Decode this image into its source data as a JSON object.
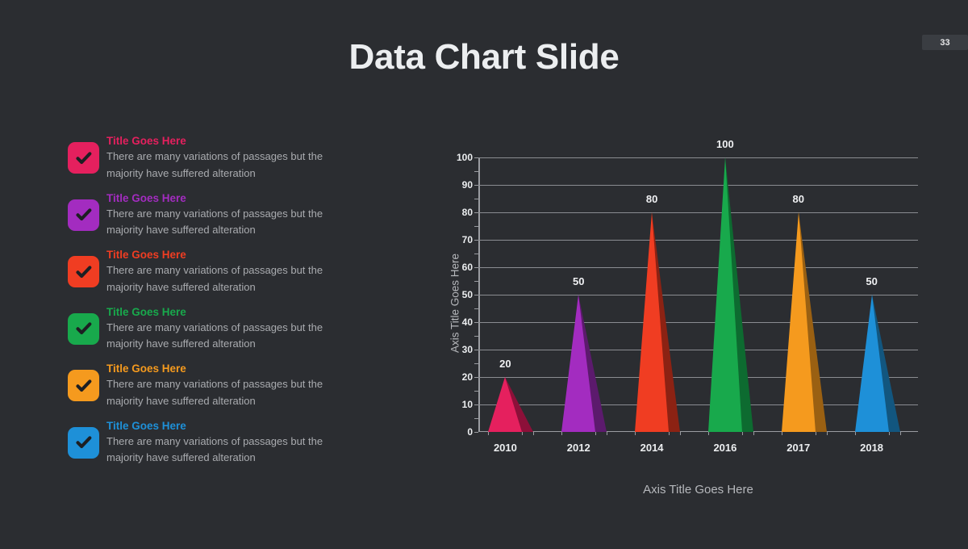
{
  "page": {
    "badge_number": "33",
    "title": "Data Chart Slide",
    "background": "#2b2d31"
  },
  "features": [
    {
      "icon": "check-square-icon",
      "color": "#e5205e",
      "title": "Title Goes Here",
      "line1": "There are many variations of passages but the",
      "line2": "majority have  suffered alteration"
    },
    {
      "icon": "check-square-icon",
      "color": "#a32cc0",
      "title": "Title Goes Here",
      "line1": "There are many variations of passages but the",
      "line2": "majority have  suffered alteration"
    },
    {
      "icon": "check-square-icon",
      "color": "#f03d22",
      "title": "Title Goes Here",
      "line1": "There are many variations of passages but the",
      "line2": "majority have  suffered alteration"
    },
    {
      "icon": "check-square-icon",
      "color": "#18a94c",
      "title": "Title Goes Here",
      "line1": "There are many variations of passages but the",
      "line2": "majority have  suffered alteration"
    },
    {
      "icon": "check-square-icon",
      "color": "#f59a1e",
      "title": "Title Goes Here",
      "line1": "There are many variations of passages but the",
      "line2": "majority have  suffered alteration"
    },
    {
      "icon": "check-square-icon",
      "color": "#1e90d8",
      "title": "Title Goes Here",
      "line1": "There are many variations of passages but the",
      "line2": "majority have  suffered alteration"
    }
  ],
  "chart_data": {
    "type": "bar",
    "title": "",
    "xlabel": "Axis Title Goes Here",
    "ylabel": "Axis Title Goes Here",
    "categories": [
      "2010",
      "2012",
      "2014",
      "2016",
      "2017",
      "2018"
    ],
    "values": [
      20,
      50,
      80,
      100,
      80,
      50
    ],
    "data_labels": [
      "20",
      "50",
      "80",
      "100",
      "80",
      "50"
    ],
    "colors": [
      "#e5205e",
      "#a32cc0",
      "#f03d22",
      "#18a94c",
      "#f59a1e",
      "#1e90d8"
    ],
    "shadow_colors": [
      "#8c1039",
      "#5c1a6d",
      "#8c2213",
      "#0d6b30",
      "#9a6012",
      "#12567f"
    ],
    "ylim": [
      0,
      100
    ],
    "ytick_labels": [
      "0",
      "10",
      "20",
      "30",
      "40",
      "50",
      "60",
      "70",
      "80",
      "90",
      "100"
    ],
    "ytick_step": 10,
    "yminor_step": 5,
    "grid": true,
    "legend": "none",
    "bar_style": "cone-3d"
  }
}
